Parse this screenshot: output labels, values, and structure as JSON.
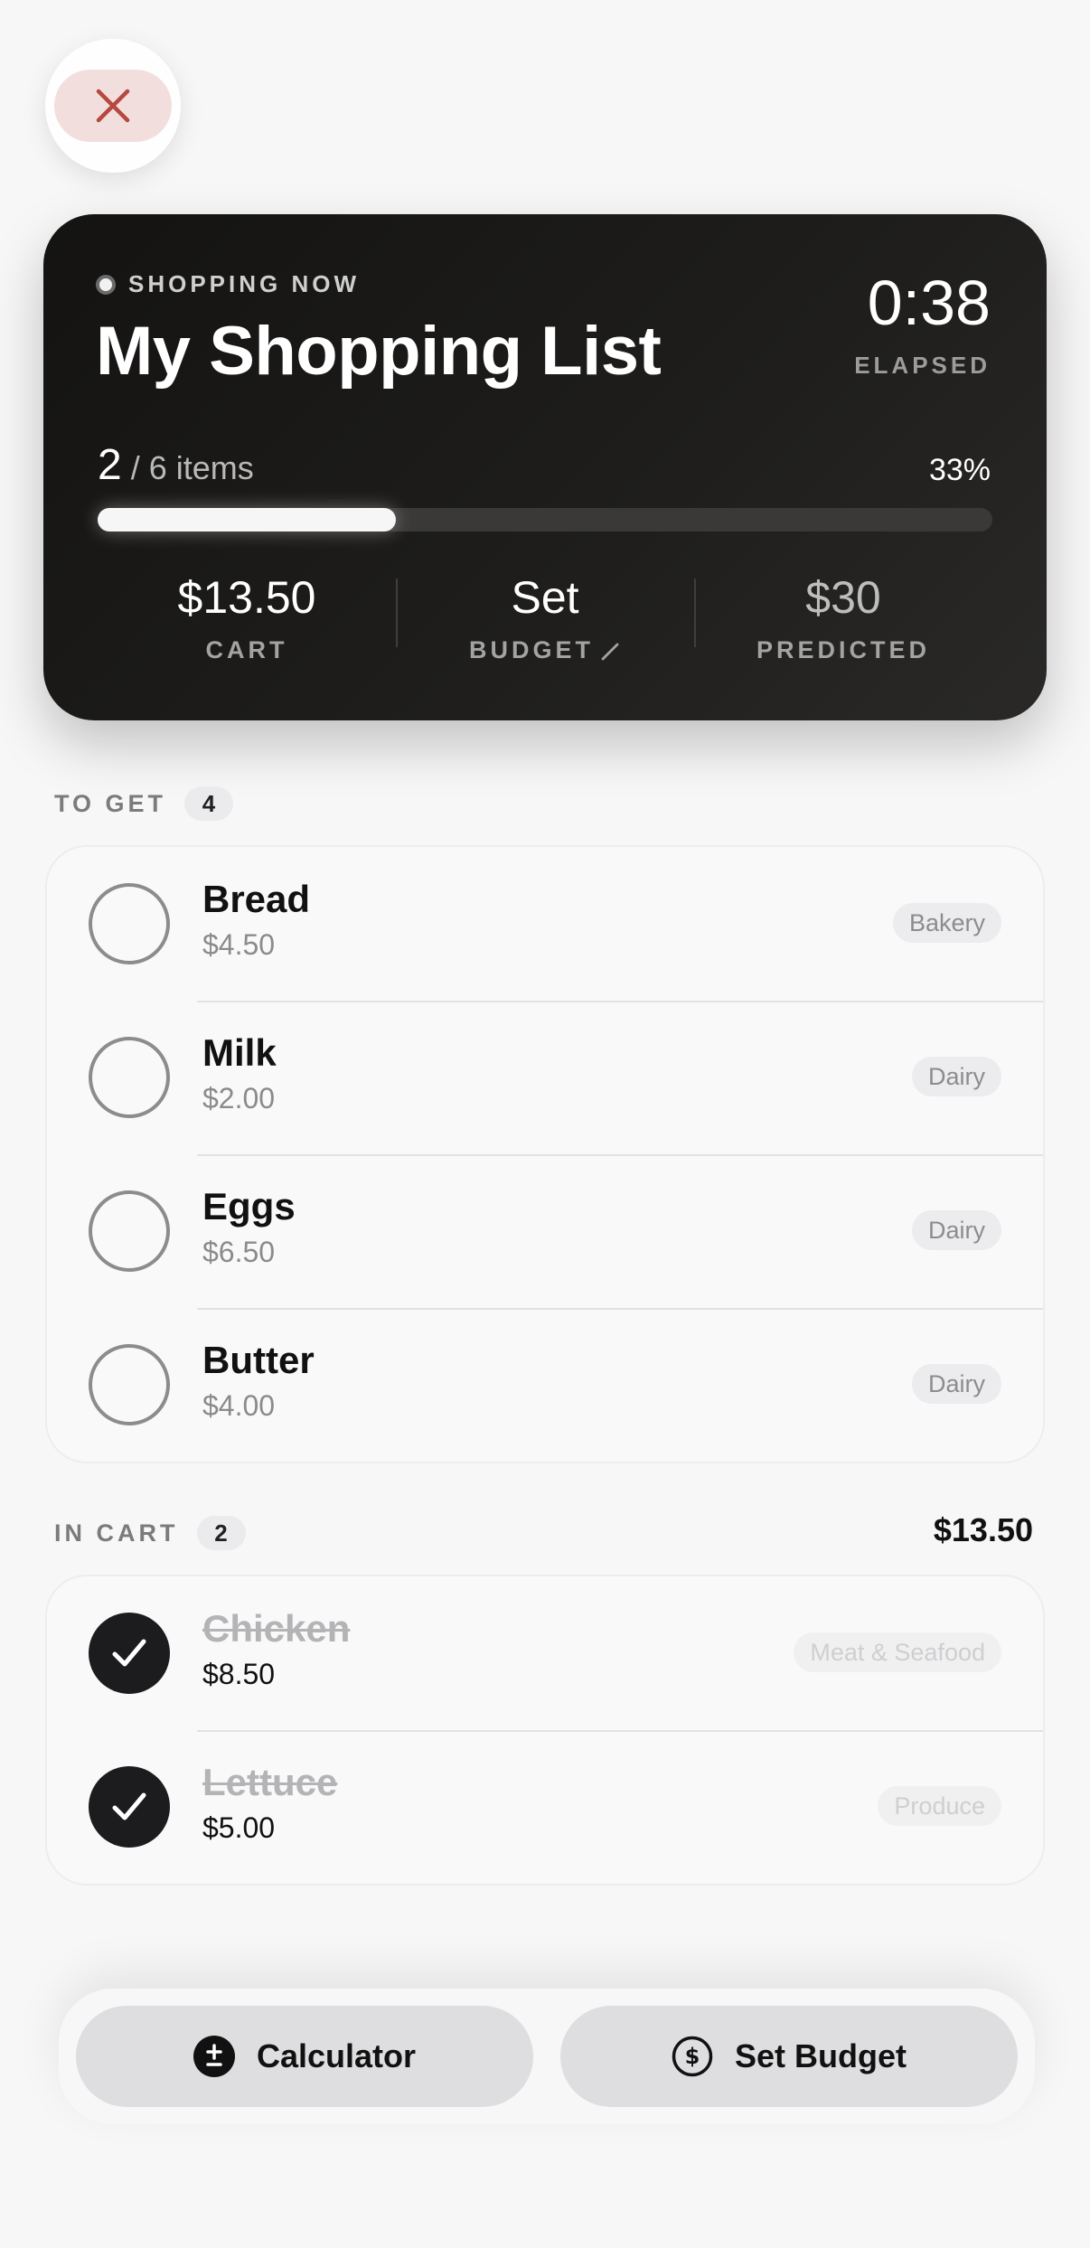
{
  "close_button": {
    "icon": "close-icon",
    "color": "#b5483f"
  },
  "hero": {
    "status": "SHOPPING NOW",
    "title": "My Shopping List",
    "timer": "0:38",
    "timer_label": "ELAPSED",
    "items_count": "2",
    "items_total": "/ 6 items",
    "percent": "33%",
    "progress_fraction": 0.333,
    "stats": {
      "cart_value": "$13.50",
      "cart_label": "CART",
      "budget_value": "Set",
      "budget_label": "BUDGET",
      "predicted_value": "$30",
      "predicted_label": "PREDICTED"
    }
  },
  "to_get": {
    "label": "TO GET",
    "count": "4",
    "items": [
      {
        "name": "Bread",
        "price": "$4.50",
        "category": "Bakery"
      },
      {
        "name": "Milk",
        "price": "$2.00",
        "category": "Dairy"
      },
      {
        "name": "Eggs",
        "price": "$6.50",
        "category": "Dairy"
      },
      {
        "name": "Butter",
        "price": "$4.00",
        "category": "Dairy"
      }
    ]
  },
  "in_cart": {
    "label": "IN CART",
    "count": "2",
    "total": "$13.50",
    "items": [
      {
        "name": "Chicken",
        "price": "$8.50",
        "category": "Meat & Seafood"
      },
      {
        "name": "Lettuce",
        "price": "$5.00",
        "category": "Produce"
      }
    ]
  },
  "bottom_bar": {
    "calculator_label": "Calculator",
    "calculator_icon": "plus-minus-icon",
    "set_budget_label": "Set Budget",
    "set_budget_icon": "dollar-icon"
  }
}
